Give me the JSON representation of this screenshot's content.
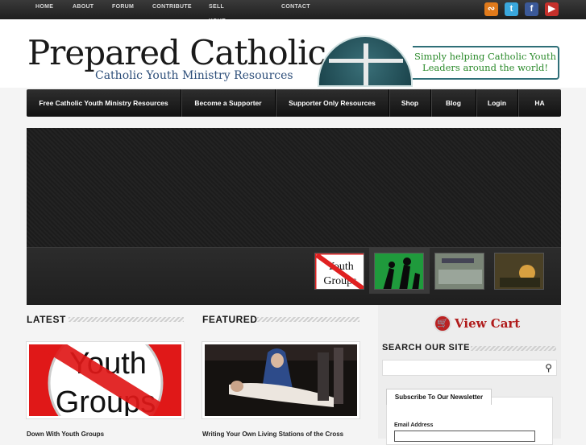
{
  "top_nav": {
    "items": [
      "HOME",
      "ABOUT",
      "FORUM",
      "CONTRIBUTE",
      "SELL YOUR STUFF",
      "CONTACT"
    ]
  },
  "social": [
    "rss-icon",
    "twitter-icon",
    "facebook-icon",
    "youtube-icon"
  ],
  "header": {
    "logo_title": "Prepared Catholic",
    "logo_subtitle": "Catholic Youth Ministry Resources",
    "tagline": "Simply helping Catholic Youth Leaders around the world!"
  },
  "main_nav": {
    "items": [
      "Free Catholic Youth Ministry Resources",
      "Become a Supporter",
      "Supporter Only Resources",
      "Shop",
      "Blog",
      "Login",
      "HA"
    ]
  },
  "latest": {
    "title": "LATEST",
    "thumb_text": [
      "Youth",
      "Groups"
    ],
    "caption": "Down With Youth Groups"
  },
  "featured": {
    "title": "FEATURED",
    "caption": "Writing Your Own Living Stations of the Cross"
  },
  "sidebar": {
    "view_cart": "View Cart",
    "search_title": "SEARCH OUR SITE",
    "newsletter_tab": "Subscribe To Our Newsletter",
    "email_label": "Email Address"
  },
  "colors": {
    "accent": "#b01c1c",
    "tagline": "#2b8a2b",
    "subtitle": "#2e4f7a"
  }
}
